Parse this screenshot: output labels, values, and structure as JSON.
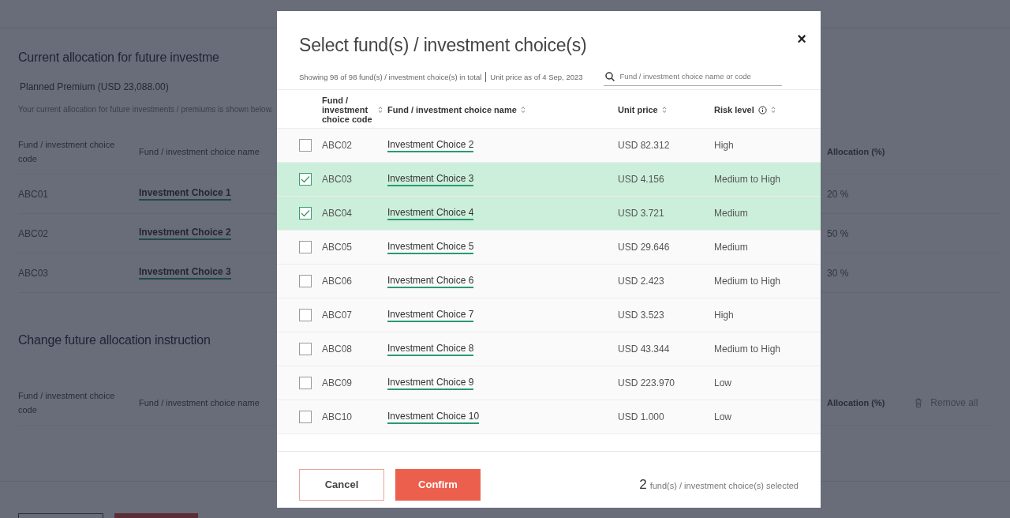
{
  "page": {
    "current": {
      "title": "Current allocation for future investme",
      "premium": "Planned Premium (USD 23,088.00)",
      "note": "Your current allocation for future investments / premiums is shown below.",
      "columns": [
        "Fund / investment choice code",
        "Fund / investment choice name",
        "Allocation (%)"
      ],
      "rows": [
        {
          "code": "ABC01",
          "name": "Investment Choice 1",
          "allocation": "20 %"
        },
        {
          "code": "ABC02",
          "name": "Investment Choice 2",
          "allocation": "50 %"
        },
        {
          "code": "ABC03",
          "name": "Investment Choice 3",
          "allocation": "30 %"
        }
      ]
    },
    "change": {
      "title": "Change future allocation instruction",
      "columns": [
        "Fund / investment choice code",
        "Fund / investment choice name",
        "Allocation (%)"
      ],
      "remove_all": "Remove all"
    }
  },
  "modal": {
    "title": "Select fund(s) / investment choice(s)",
    "close": "×",
    "summary": "Showing 98 of 98 fund(s) / investment choice(s) in total",
    "price_date": "Unit price as of 4 Sep, 2023",
    "search": {
      "placeholder": "Fund / investment choice name or code"
    },
    "columns": [
      "Fund / investment choice code",
      "Fund / investment choice name",
      "Unit price",
      "Risk level"
    ],
    "rows": [
      {
        "code": "ABC02",
        "name": "Investment Choice 2",
        "price": "USD 82.312",
        "risk": "High",
        "checked": false
      },
      {
        "code": "ABC03",
        "name": "Investment Choice 3",
        "price": "USD 4.156",
        "risk": "Medium to High",
        "checked": true
      },
      {
        "code": "ABC04",
        "name": "Investment Choice 4",
        "price": "USD 3.721",
        "risk": "Medium",
        "checked": true
      },
      {
        "code": "ABC05",
        "name": "Investment Choice 5",
        "price": "USD 29.646",
        "risk": "Medium",
        "checked": false
      },
      {
        "code": "ABC06",
        "name": "Investment Choice 6",
        "price": "USD 2.423",
        "risk": "Medium to High",
        "checked": false
      },
      {
        "code": "ABC07",
        "name": "Investment Choice 7",
        "price": "USD 3.523",
        "risk": "High",
        "checked": false
      },
      {
        "code": "ABC08",
        "name": "Investment Choice 8",
        "price": "USD 43.344",
        "risk": "Medium to High",
        "checked": false
      },
      {
        "code": "ABC09",
        "name": "Investment Choice 9",
        "price": "USD 223.970",
        "risk": "Low",
        "checked": false
      },
      {
        "code": "ABC10",
        "name": "Investment Choice 10",
        "price": "USD 1.000",
        "risk": "Low",
        "checked": false
      }
    ],
    "cancel": "Cancel",
    "confirm": "Confirm",
    "selected_count": "2",
    "selected_label": "fund(s) / investment choice(s) selected"
  }
}
